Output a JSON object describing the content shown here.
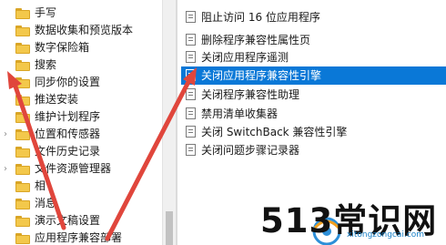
{
  "tree": {
    "items": [
      {
        "label": "手写",
        "expandable": false
      },
      {
        "label": "数据收集和预览版本",
        "expandable": false
      },
      {
        "label": "数字保险箱",
        "expandable": false
      },
      {
        "label": "搜索",
        "expandable": false
      },
      {
        "label": "同步你的设置",
        "expandable": false
      },
      {
        "label": "推送安装",
        "expandable": false
      },
      {
        "label": "维护计划程序",
        "expandable": false
      },
      {
        "label": "位置和传感器",
        "expandable": true
      },
      {
        "label": "文件历史记录",
        "expandable": false
      },
      {
        "label": "文件资源管理器",
        "expandable": true
      },
      {
        "label": "相",
        "expandable": false
      },
      {
        "label": "消息",
        "expandable": false
      },
      {
        "label": "演示文稿设置",
        "expandable": false
      },
      {
        "label": "应用程序兼容部署",
        "expandable": false
      }
    ]
  },
  "policies": {
    "items": [
      {
        "label": "阻止访问 16 位应用程序",
        "selected": false
      },
      {
        "label": "删除程序兼容性属性页",
        "selected": false
      },
      {
        "label": "关闭应用程序遥测",
        "selected": false
      },
      {
        "label": "关闭应用程序兼容性引擎",
        "selected": true
      },
      {
        "label": "关闭程序兼容性助理",
        "selected": false
      },
      {
        "label": "禁用清单收集器",
        "selected": false
      },
      {
        "label": "关闭 SwitchBack 兼容性引擎",
        "selected": false
      },
      {
        "label": "关闭问题步骤记录器",
        "selected": false
      }
    ]
  },
  "watermark": {
    "main": "513常识网",
    "sub": "xitongzongcai.com"
  },
  "colors": {
    "selection": "#0a78d7",
    "arrow": "#e0463c",
    "folder": "#f3c84b"
  }
}
